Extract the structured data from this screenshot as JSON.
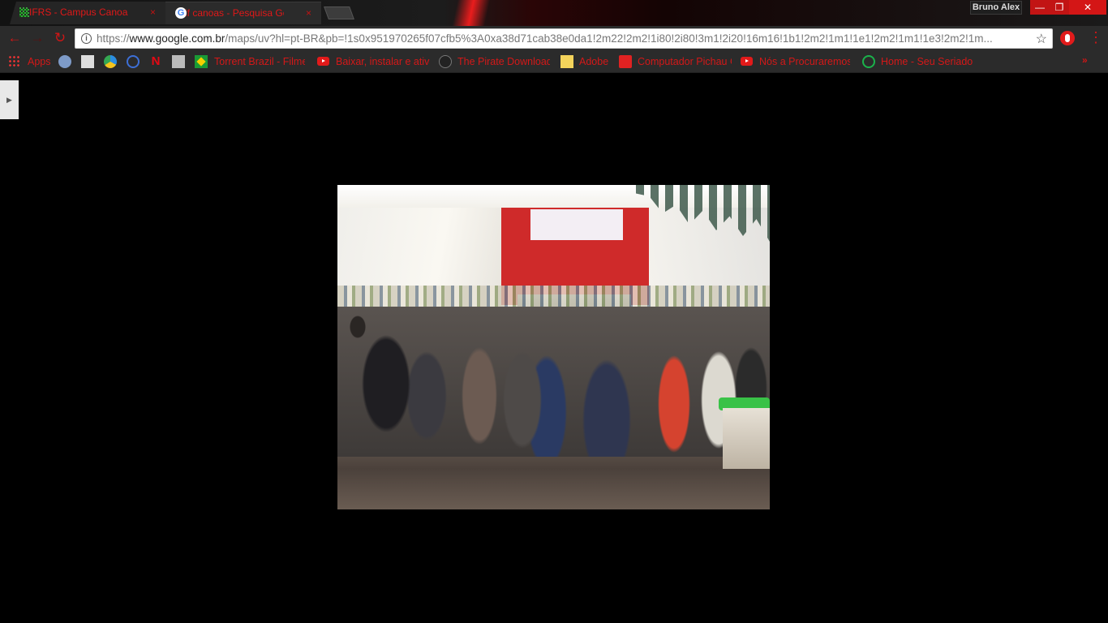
{
  "tabs": [
    {
      "title": "IFRS - Campus Canoas",
      "close": "×",
      "favicon": "grid-icon"
    },
    {
      "title": "if canoas - Pesquisa Google",
      "close": "×",
      "favicon": "google-icon"
    }
  ],
  "window": {
    "profile_name": "Bruno Alex",
    "minimize": "—",
    "maximize": "❐",
    "close": "✕"
  },
  "toolbar": {
    "back": "←",
    "forward": "→",
    "reload": "↻",
    "url_scheme": "https://",
    "url_host": "www.google.com.br",
    "url_path": "/maps/uv?hl=pt-BR&pb=!1s0x951970265f07cfb5%3A0xa38d71cab38e0da1!2m22!2m2!1i80!2i80!3m1!2i20!16m16!1b1!2m2!1m1!1e1!2m2!1m1!1e3!2m2!1m...",
    "info": "i",
    "star": "☆",
    "menu": "⋮"
  },
  "bookmarks": {
    "apps": "Apps",
    "items": [
      {
        "label": "Torrent Brazil - Filmes",
        "icon": "brazil-flag-icon"
      },
      {
        "label": "Baixar, instalar e ativar",
        "icon": "youtube-icon"
      },
      {
        "label": "The Pirate Download",
        "icon": "pirate-icon"
      },
      {
        "label": "Adobe",
        "icon": "note-icon"
      },
      {
        "label": "Computador Pichau G",
        "icon": "pichau-icon"
      },
      {
        "label": "Nós a Procuraremos",
        "icon": "youtube-icon"
      },
      {
        "label": "Home - Seu Seriado",
        "icon": "play-icon"
      }
    ],
    "overflow": "»"
  },
  "content": {
    "side_toggle": "▶"
  },
  "colors": {
    "accent": "#d41818",
    "background": "#000000",
    "chrome": "#2b2b2b"
  }
}
